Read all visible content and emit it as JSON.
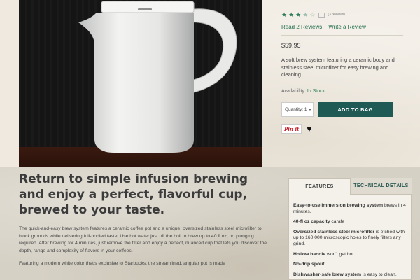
{
  "product": {
    "rating": 3.5,
    "review_count_label": "(3 reviews)",
    "read_reviews_label": "Read 2 Reviews",
    "write_review_label": "Write a Review",
    "price": "$59.95",
    "description": "A soft brew system featuring a ceramic body and stainless steel microfilter for easy brewing and cleaning.",
    "availability_label": "Availability:",
    "availability_value": "In Stock",
    "quantity_label": "Quantity: 1",
    "add_to_bag_label": "ADD TO BAG",
    "pin_label": "Pin it"
  },
  "content": {
    "headline": "Return to simple infusion brewing and enjoy a perfect, flavorful cup, brewed to your taste.",
    "paragraphs": [
      "The quick-and-easy brew system features a ceramic coffee pot and a unique, oversized stainless steel microfilter to block grounds while delivering full-bodied taste. Use hot water just off the boil to brew up to 40 fl oz, no plunging required. After brewing for 4 minutes, just remove the filter and enjoy a perfect, nuanced cup that lets you discover the depth, range and complexity of flavors in your coffees.",
      "Featuring a modern white color that's exclusive to Starbucks, the streamlined, angular pot is made"
    ]
  },
  "tabs": {
    "features_label": "FEATURES",
    "technical_label": "TECHNICAL DETAILS",
    "features": [
      {
        "bold": "Easy-to-use immersion brewing system",
        "text": " brews in 4 minutes."
      },
      {
        "bold": "40-fl oz capacity",
        "text": " carafe"
      },
      {
        "bold": "Oversized stainless steel microfilter",
        "text": " is etched with up to 160,000 microscopic holes to finely filters any grind."
      },
      {
        "bold": "Hollow handle",
        "text": " won't get hot."
      },
      {
        "bold": "No-drip spout",
        "text": ""
      },
      {
        "bold": "Dishwasher-safe brew system",
        "text": " is easy to clean."
      }
    ]
  },
  "colors": {
    "accent_green": "#1f5a54",
    "link_green": "#1e6b4b",
    "pinterest_red": "#c8232c"
  }
}
